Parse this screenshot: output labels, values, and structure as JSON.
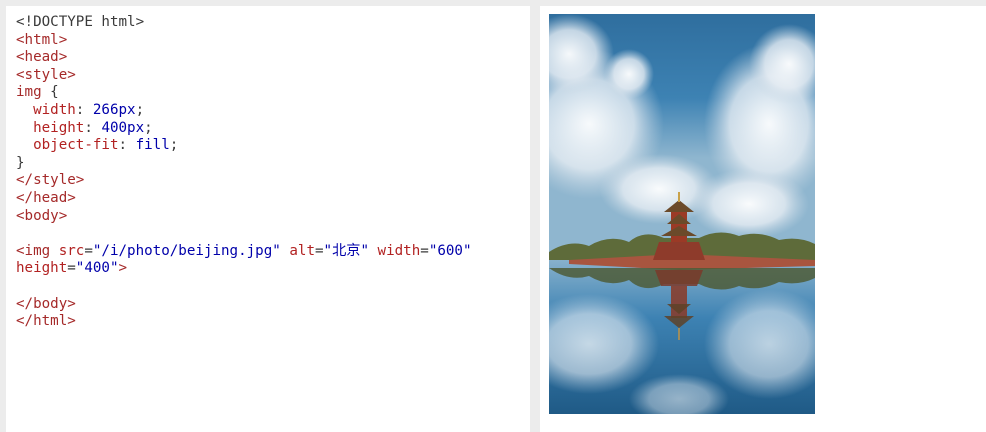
{
  "editor": {
    "lines": [
      {
        "parts": [
          {
            "t": "<!DOCTYPE html>",
            "c": "plain"
          }
        ]
      },
      {
        "parts": [
          {
            "t": "<html>",
            "c": "tag"
          }
        ]
      },
      {
        "parts": [
          {
            "t": "<head>",
            "c": "tag"
          }
        ]
      },
      {
        "parts": [
          {
            "t": "<style>",
            "c": "tag"
          }
        ]
      },
      {
        "parts": [
          {
            "t": "img ",
            "c": "sel"
          },
          {
            "t": "{",
            "c": "plain"
          }
        ]
      },
      {
        "parts": [
          {
            "t": "  width",
            "c": "prop"
          },
          {
            "t": ": ",
            "c": "plain"
          },
          {
            "t": "266px",
            "c": "pval"
          },
          {
            "t": ";",
            "c": "plain"
          }
        ]
      },
      {
        "parts": [
          {
            "t": "  height",
            "c": "prop"
          },
          {
            "t": ": ",
            "c": "plain"
          },
          {
            "t": "400px",
            "c": "pval"
          },
          {
            "t": ";",
            "c": "plain"
          }
        ]
      },
      {
        "parts": [
          {
            "t": "  object-fit",
            "c": "prop"
          },
          {
            "t": ": ",
            "c": "plain"
          },
          {
            "t": "fill",
            "c": "pval"
          },
          {
            "t": ";",
            "c": "plain"
          }
        ]
      },
      {
        "parts": [
          {
            "t": "}",
            "c": "plain"
          }
        ]
      },
      {
        "parts": [
          {
            "t": "</style>",
            "c": "tag"
          }
        ]
      },
      {
        "parts": [
          {
            "t": "</head>",
            "c": "tag"
          }
        ]
      },
      {
        "parts": [
          {
            "t": "<body>",
            "c": "tag"
          }
        ]
      },
      {
        "parts": [
          {
            "t": "",
            "c": "plain"
          }
        ]
      },
      {
        "parts": [
          {
            "t": "<img ",
            "c": "tag"
          },
          {
            "t": "src",
            "c": "attr"
          },
          {
            "t": "=",
            "c": "plain"
          },
          {
            "t": "\"/i/photo/beijing.jpg\"",
            "c": "val"
          },
          {
            "t": " ",
            "c": "plain"
          },
          {
            "t": "alt",
            "c": "attr"
          },
          {
            "t": "=",
            "c": "plain"
          },
          {
            "t": "\"北京\"",
            "c": "val"
          },
          {
            "t": " ",
            "c": "plain"
          },
          {
            "t": "width",
            "c": "attr"
          },
          {
            "t": "=",
            "c": "plain"
          },
          {
            "t": "\"600\"",
            "c": "val"
          }
        ]
      },
      {
        "parts": [
          {
            "t": "height",
            "c": "attr"
          },
          {
            "t": "=",
            "c": "plain"
          },
          {
            "t": "\"400\"",
            "c": "val"
          },
          {
            "t": ">",
            "c": "tag"
          }
        ]
      },
      {
        "parts": [
          {
            "t": "",
            "c": "plain"
          }
        ]
      },
      {
        "parts": [
          {
            "t": "</body>",
            "c": "tag"
          }
        ]
      },
      {
        "parts": [
          {
            "t": "</html>",
            "c": "tag"
          }
        ]
      }
    ]
  },
  "result": {
    "image_subject": "beijing-photo"
  }
}
